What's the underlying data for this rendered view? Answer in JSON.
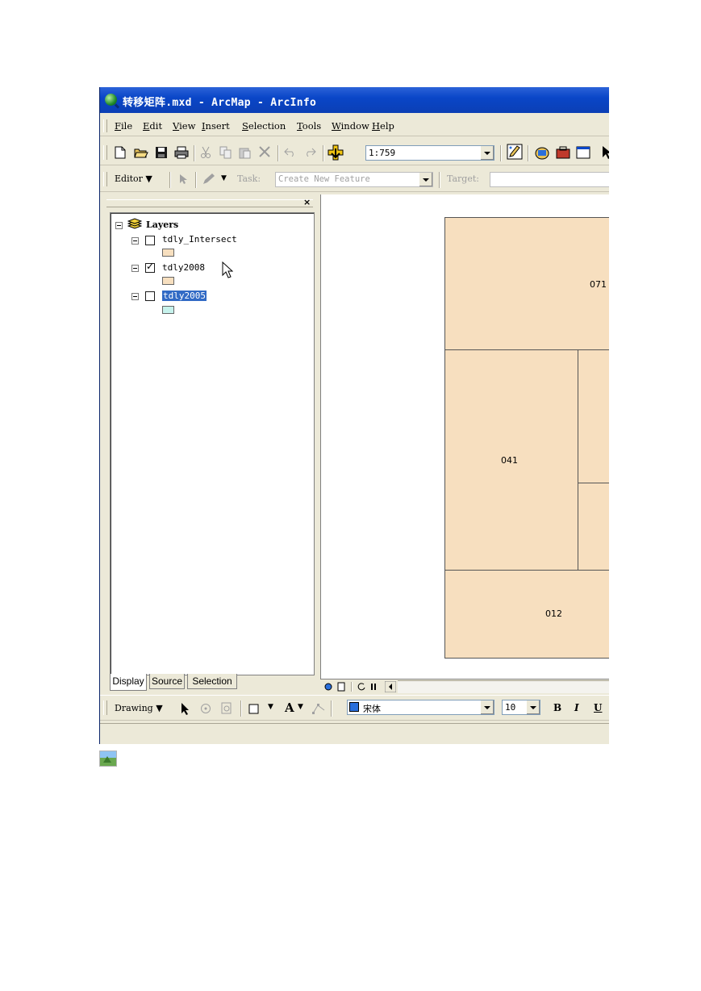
{
  "window": {
    "title": "转移矩阵.mxd - ArcMap - ArcInfo"
  },
  "menubar": {
    "items": [
      {
        "u": "F",
        "rest": "ile"
      },
      {
        "u": "E",
        "rest": "dit"
      },
      {
        "u": "V",
        "rest": "iew"
      },
      {
        "u": "I",
        "rest": "nsert"
      },
      {
        "u": "S",
        "rest": "election"
      },
      {
        "u": "T",
        "rest": "ools"
      },
      {
        "u": "W",
        "rest": "indow"
      },
      {
        "u": "H",
        "rest": "elp"
      }
    ]
  },
  "standard_toolbar": {
    "scale": "1:759"
  },
  "editor_toolbar": {
    "editor_label": "Editor",
    "editor_underline": "r",
    "task_label": "Task:",
    "task_value": "Create New Feature",
    "target_label": "Target:"
  },
  "toc": {
    "close": "×",
    "root": "Layers",
    "layers": [
      {
        "name": "tdly_Intersect",
        "checked": false,
        "color": "#f7dfbf"
      },
      {
        "name": "tdly2008",
        "checked": true,
        "color": "#f7dfbf"
      },
      {
        "name": "tdly2005",
        "checked": false,
        "color": "#c6f2ec",
        "selected": true
      }
    ],
    "tabs": [
      "Display",
      "Source",
      "Selection"
    ]
  },
  "map": {
    "parcels": [
      {
        "label": "071"
      },
      {
        "label": "041"
      },
      {
        "label": "012"
      }
    ]
  },
  "drawing_toolbar": {
    "label": "Drawing",
    "font": "宋体",
    "size": "10",
    "bold": "B",
    "italic": "I",
    "underline": "U",
    "text_tool": "A"
  },
  "colors": {
    "parcel_fill": "#f7dfbf",
    "selection": "#316ac5",
    "titlebar": "#0a46c8"
  }
}
